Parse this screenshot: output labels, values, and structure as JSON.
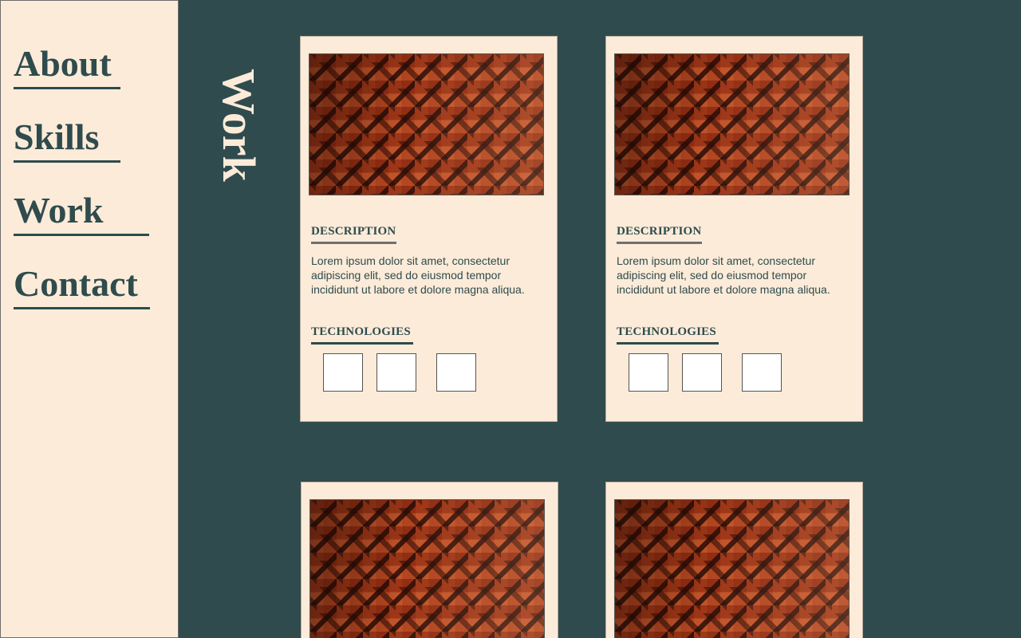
{
  "sidebar": {
    "items": [
      {
        "label": "About"
      },
      {
        "label": "Skills"
      },
      {
        "label": "Work"
      },
      {
        "label": "Contact"
      }
    ]
  },
  "section": {
    "title": "Work"
  },
  "cards": [
    {
      "description_heading": "DESCRIPTION",
      "description": "Lorem ipsum dolor sit amet, consectetur adipiscing elit, sed do eiusmod tempor incididunt ut labore et dolore magna aliqua.",
      "technologies_heading": "TECHNOLOGIES"
    },
    {
      "description_heading": "DESCRIPTION",
      "description": "Lorem ipsum dolor sit amet, consectetur adipiscing elit, sed do eiusmod tempor incididunt ut labore et dolore magna aliqua.",
      "technologies_heading": "TECHNOLOGIES"
    }
  ],
  "colors": {
    "background": "#2f4b4d",
    "panel": "#fbebd8",
    "accent": "#2f4b4d"
  }
}
